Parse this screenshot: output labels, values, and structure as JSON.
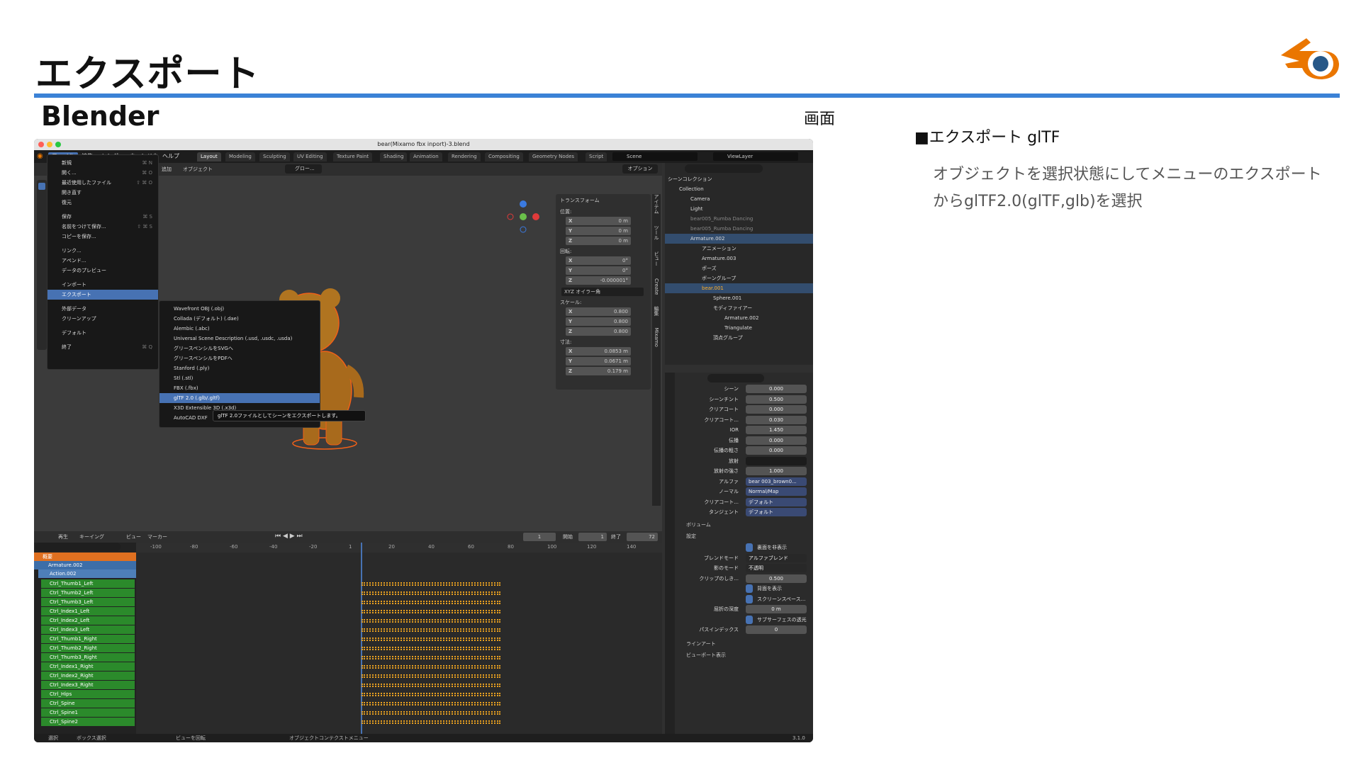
{
  "slide": {
    "title": "エクスポート",
    "subtitle": "Blender",
    "screen_label": "画面",
    "right_heading": "■エクスポート glTF",
    "right_body": "オブジェクトを選択状態にしてメニューのエクスポートからglTF2.0(glTF,glb)を選択",
    "accent_color": "#3b82d6",
    "logo_icon": "blender-logo-icon"
  },
  "blender": {
    "window_title": "bear(Mixamo fbx inport)-3.blend",
    "menubar": [
      "ファイル",
      "編集",
      "レンダー",
      "ウィンドウ",
      "ヘルプ"
    ],
    "workspace_tabs": [
      "Layout",
      "Modeling",
      "Sculpting",
      "UV Editing",
      "Texture Paint",
      "Shading",
      "Animation",
      "Rendering",
      "Compositing",
      "Geometry Nodes",
      "Script"
    ],
    "scene_name": "Scene",
    "view_layer": "ViewLayer",
    "viewport_header": [
      "追加",
      "オブジェクト",
      "グロー..."
    ],
    "viewport_options": "オプション",
    "file_menu": [
      {
        "label": "新規",
        "shortcut": "⌘ N"
      },
      {
        "label": "開く...",
        "shortcut": "⌘ O"
      },
      {
        "label": "最近使用したファイル",
        "shortcut": "⇧ ⌘ O"
      },
      {
        "label": "開き直す",
        "shortcut": ""
      },
      {
        "label": "復元",
        "shortcut": ""
      },
      {
        "label": "保存",
        "shortcut": "⌘ S"
      },
      {
        "label": "名前をつけて保存...",
        "shortcut": "⇧ ⌘ S"
      },
      {
        "label": "コピーを保存...",
        "shortcut": ""
      },
      {
        "label": "リンク...",
        "shortcut": ""
      },
      {
        "label": "アペンド...",
        "shortcut": ""
      },
      {
        "label": "データのプレビュー",
        "shortcut": ""
      },
      {
        "label": "インポート",
        "shortcut": ""
      },
      {
        "label": "エクスポート",
        "shortcut": ""
      },
      {
        "label": "外部データ",
        "shortcut": ""
      },
      {
        "label": "クリーンアップ",
        "shortcut": ""
      },
      {
        "label": "デフォルト",
        "shortcut": ""
      },
      {
        "label": "終了",
        "shortcut": "⌘ Q"
      }
    ],
    "export_submenu": [
      "Wavefront OBJ (.obj)",
      "Collada (デフォルト) (.dae)",
      "Alembic (.abc)",
      "Universal Scene Description (.usd, .usdc, .usda)",
      "グリースペンシルをSVGへ",
      "グリースペンシルをPDFへ",
      "Stanford (.ply)",
      "Stl (.stl)",
      "FBX (.fbx)",
      "glTF 2.0 (.glb/.gltf)",
      "X3D Extensible 3D (.x3d)",
      "AutoCAD DXF"
    ],
    "tooltip": "glTF 2.0ファイルとしてシーンをエクスポートします。",
    "npanel": {
      "header": "トランスフォーム",
      "location_label": "位置:",
      "location": [
        [
          "X",
          "0 m"
        ],
        [
          "Y",
          "0 m"
        ],
        [
          "Z",
          "0 m"
        ]
      ],
      "rotation_label": "回転:",
      "rotation": [
        [
          "X",
          "0°"
        ],
        [
          "Y",
          "0°"
        ],
        [
          "Z",
          "-0.000001°"
        ]
      ],
      "rotation_mode": "XYZ オイラー角",
      "scale_label": "スケール:",
      "scale": [
        [
          "X",
          "0.800"
        ],
        [
          "Y",
          "0.800"
        ],
        [
          "Z",
          "0.800"
        ]
      ],
      "dimensions_label": "寸法:",
      "dimensions": [
        [
          "X",
          "0.0853 m"
        ],
        [
          "Y",
          "0.0671 m"
        ],
        [
          "Z",
          "0.179 m"
        ]
      ],
      "side_tabs": [
        "アイテム",
        "ツール",
        "ビュー",
        "Create",
        "編集",
        "Mixamo"
      ]
    },
    "outliner": [
      "シーンコレクション",
      "Collection",
      "Camera",
      "Light",
      "bear005_Rumba Dancing",
      "bear005_Rumba Dancing",
      "Armature.002",
      "アニメーション",
      "Armature.003",
      "ポーズ",
      "ボーングループ",
      "bear.001",
      "Sphere.001",
      "モディファイアー",
      "Armature.002",
      "Triangulate",
      "頂点グループ"
    ],
    "properties": [
      [
        "シーン",
        "0.000"
      ],
      [
        "シーンチント",
        "0.500"
      ],
      [
        "クリアコート",
        "0.000"
      ],
      [
        "クリアコート...",
        "0.030"
      ],
      [
        "IOR",
        "1.450"
      ],
      [
        "伝播",
        "0.000"
      ],
      [
        "伝播の粗さ",
        "0.000"
      ],
      [
        "放射",
        ""
      ],
      [
        "放射の強さ",
        "1.000"
      ],
      [
        "アルファ",
        "bear 003_brown0..."
      ],
      [
        "ノーマル",
        "Normal/Map"
      ],
      [
        "クリアコート...",
        "デフォルト"
      ],
      [
        "タンジェント",
        "デフォルト"
      ]
    ],
    "props_sections": [
      "ボリューム",
      "設定",
      "ラインアート",
      "ビューポート表示"
    ],
    "settings": [
      [
        "",
        "裏面を非表示"
      ],
      [
        "ブレンドモード",
        "アルファブレンド"
      ],
      [
        "影のモード",
        "不透明"
      ],
      [
        "クリップのしき...",
        "0.500"
      ],
      [
        "",
        "背面を表示"
      ],
      [
        "",
        "スクリーンスペース..."
      ],
      [
        "屈折の深度",
        "0 m"
      ],
      [
        "",
        "サブサーフェスの透光"
      ],
      [
        "パスインデックス",
        "0"
      ]
    ],
    "timeline": {
      "header": [
        "再生",
        "キーイング",
        "ビュー",
        "マーカー"
      ],
      "current_frame": "1",
      "start_label": "開始",
      "start": "1",
      "end_label": "終了",
      "end": "72",
      "ruler": [
        "-100",
        "-80",
        "-60",
        "-40",
        "-20",
        "1",
        "20",
        "40",
        "60",
        "80",
        "100",
        "120",
        "140"
      ],
      "summary": "概要",
      "object": "Armature.002",
      "action": "Action.002",
      "channels": [
        "Ctrl_Thumb1_Left",
        "Ctrl_Thumb2_Left",
        "Ctrl_Thumb3_Left",
        "Ctrl_Index1_Left",
        "Ctrl_Index2_Left",
        "Ctrl_Index3_Left",
        "Ctrl_Thumb1_Right",
        "Ctrl_Thumb2_Right",
        "Ctrl_Thumb3_Right",
        "Ctrl_Index1_Right",
        "Ctrl_Index2_Right",
        "Ctrl_Index3_Right",
        "Ctrl_Hips",
        "Ctrl_Spine",
        "Ctrl_Spine1",
        "Ctrl_Spine2"
      ]
    },
    "status": [
      "選択",
      "ボックス選択",
      "ビューを回転",
      "オブジェクトコンテクストメニュー",
      "3.1.0"
    ]
  }
}
